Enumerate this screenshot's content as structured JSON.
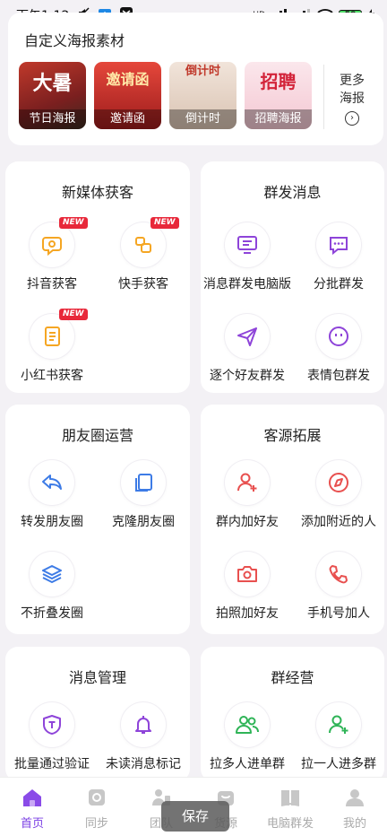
{
  "status_bar": {
    "time": "下午1:12",
    "network": "HD",
    "battery": "58"
  },
  "poster_section": {
    "title": "自定义海报素材",
    "posters": [
      {
        "art": "大暑",
        "label": "节日海报"
      },
      {
        "art": "邀请函",
        "label": "邀请函"
      },
      {
        "art": "倒计时",
        "label": "倒计时"
      },
      {
        "art": "招聘",
        "label": "招聘海报"
      }
    ],
    "more": {
      "line1": "更多",
      "line2": "海报"
    }
  },
  "cards": {
    "new_media": {
      "title": "新媒体获客",
      "items": [
        {
          "label": "抖音获客",
          "badge": "NEW"
        },
        {
          "label": "快手获客",
          "badge": "NEW"
        },
        {
          "label": "小红书获客",
          "badge": "NEW"
        }
      ]
    },
    "group_send": {
      "title": "群发消息",
      "items": [
        {
          "label": "消息群发电脑版"
        },
        {
          "label": "分批群发"
        },
        {
          "label": "逐个好友群发"
        },
        {
          "label": "表情包群发"
        }
      ]
    },
    "moments": {
      "title": "朋友圈运营",
      "items": [
        {
          "label": "转发朋友圈"
        },
        {
          "label": "克隆朋友圈"
        },
        {
          "label": "不折叠发圈"
        }
      ]
    },
    "customers": {
      "title": "客源拓展",
      "items": [
        {
          "label": "群内加好友"
        },
        {
          "label": "添加附近的人"
        },
        {
          "label": "拍照加好友"
        },
        {
          "label": "手机号加人"
        }
      ]
    },
    "messages": {
      "title": "消息管理",
      "items": [
        {
          "label": "批量通过验证"
        },
        {
          "label": "未读消息标记"
        }
      ]
    },
    "groups": {
      "title": "群经营",
      "items": [
        {
          "label": "拉多人进单群"
        },
        {
          "label": "拉一人进多群"
        }
      ]
    }
  },
  "tab_bar": {
    "tabs": [
      {
        "label": "首页"
      },
      {
        "label": "同步"
      },
      {
        "label": "团队"
      },
      {
        "label": "货源"
      },
      {
        "label": "电脑群发"
      },
      {
        "label": "我的"
      }
    ]
  },
  "save_button": "保存",
  "colors": {
    "accent": "#7b3fe4",
    "badge": "#e8283a",
    "orange": "#f5a623",
    "blue": "#3d7be6",
    "red": "#e8504f",
    "green": "#2fb457"
  }
}
